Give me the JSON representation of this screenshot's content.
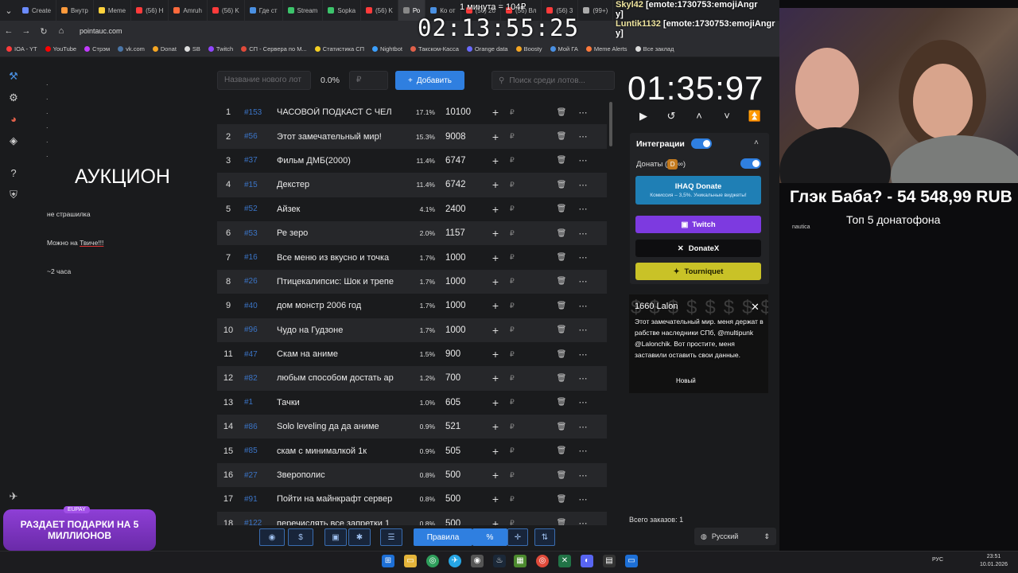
{
  "browser": {
    "tabs": [
      "Create",
      "Внутр",
      "Meme",
      "(56) Н",
      "Amruh",
      "(56) K",
      "Где ст",
      "Stream",
      "Sopka",
      "(56) K",
      "Ро",
      "Ко от",
      "(56) 2б",
      "(56) Вл",
      "(56) 3",
      "(99+)"
    ],
    "url": "pointauc.com",
    "bookmarks": [
      "IOA - YT",
      "YouTube",
      "Стрэм",
      "vk.com",
      "Donat",
      "SB",
      "Twitch",
      "СП - Сервера по М...",
      "Статистика СП",
      "Nightbot",
      "Такском-Касса",
      "Orange data",
      "Boosty",
      "Мой ГА",
      "Meme Alerts",
      "Все заклад"
    ]
  },
  "overlay": {
    "timer_label": "1 минута = 104₽",
    "timer": "02:13:55:25",
    "chat": [
      {
        "name": "Skyl42",
        "text": "[emote:1730753:emojiAngr"
      },
      {
        "name": "",
        "text": "y]"
      },
      {
        "name": "Luntik1132",
        "text": "[emote:1730753:emojiAngr"
      },
      {
        "name": "",
        "text": "y]"
      }
    ]
  },
  "notes": {
    "dots": [
      ".",
      ".",
      ".",
      ".",
      ".",
      "."
    ],
    "title": "АУКЦИОН",
    "line1": "не страшилка",
    "line2_prefix": "Можно на",
    "line2_link": "Твиче!!!",
    "line3": "~2 часа"
  },
  "controls": {
    "new_lot_placeholder": "Название нового лот",
    "percent": "0.0%",
    "rub_placeholder": "₽",
    "add_label": "Добавить",
    "search_placeholder": "Поиск среди лотов..."
  },
  "lots": [
    {
      "n": "1",
      "id": "#153",
      "name": "ЧАСОВОЙ ПОДКАСТ С ЧЕЛ",
      "pct": "17.1%",
      "amount": "10100"
    },
    {
      "n": "2",
      "id": "#56",
      "name": "Этот замечательный мир!",
      "pct": "15.3%",
      "amount": "9008"
    },
    {
      "n": "3",
      "id": "#37",
      "name": "Фильм ДМБ(2000)",
      "pct": "11.4%",
      "amount": "6747"
    },
    {
      "n": "4",
      "id": "#15",
      "name": "Декстер",
      "pct": "11.4%",
      "amount": "6742"
    },
    {
      "n": "5",
      "id": "#52",
      "name": "Айзек",
      "pct": "4.1%",
      "amount": "2400"
    },
    {
      "n": "6",
      "id": "#53",
      "name": "Ре зеро",
      "pct": "2.0%",
      "amount": "1157"
    },
    {
      "n": "7",
      "id": "#16",
      "name": "Все меню из вкусно и точка",
      "pct": "1.7%",
      "amount": "1000"
    },
    {
      "n": "8",
      "id": "#26",
      "name": "Птицекалипсис: Шок и трепе",
      "pct": "1.7%",
      "amount": "1000"
    },
    {
      "n": "9",
      "id": "#40",
      "name": "дом монстр 2006 год",
      "pct": "1.7%",
      "amount": "1000"
    },
    {
      "n": "10",
      "id": "#96",
      "name": "Чудо на Гудзоне",
      "pct": "1.7%",
      "amount": "1000"
    },
    {
      "n": "11",
      "id": "#47",
      "name": "Скам на аниме",
      "pct": "1.5%",
      "amount": "900"
    },
    {
      "n": "12",
      "id": "#82",
      "name": "любым способом достать ар",
      "pct": "1.2%",
      "amount": "700"
    },
    {
      "n": "13",
      "id": "#1",
      "name": "Тачки",
      "pct": "1.0%",
      "amount": "605"
    },
    {
      "n": "14",
      "id": "#86",
      "name": "Solo leveling да да аниме",
      "pct": "0.9%",
      "amount": "521"
    },
    {
      "n": "15",
      "id": "#85",
      "name": "скам с минималкой 1к",
      "pct": "0.9%",
      "amount": "505"
    },
    {
      "n": "16",
      "id": "#27",
      "name": "Зверополис",
      "pct": "0.8%",
      "amount": "500"
    },
    {
      "n": "17",
      "id": "#91",
      "name": "Пойти на майнкрафт сервер",
      "pct": "0.8%",
      "amount": "500"
    },
    {
      "n": "18",
      "id": "#122",
      "name": "перечислять все запретки 1",
      "pct": "0.8%",
      "amount": "500"
    }
  ],
  "lot_rub_symbol": "₽",
  "bottom": {
    "rules_label": "Правила",
    "percent_icon": "%",
    "total_label": "Всего заказов:",
    "total_value": "1",
    "language": "Русский"
  },
  "right": {
    "stopwatch": "01:35:97",
    "integrations_title": "Интеграции",
    "donates_label": "Донаты (",
    "donates_suffix": ")",
    "ihaq_label": "IHAQ Donate",
    "ihaq_sub": "Комиссия – 3,5%. Уникальные виджеты!",
    "twitch_label": "Twitch",
    "donatex_label": "DonateX",
    "tourniquet_label": "Tourniquet"
  },
  "donation": {
    "head": "1660 Lalon",
    "text": "Этот замечательный мир. меня держат в рабстве наследники СПб, @multipunk @Lalonchik. Вот простите, меня заставили оставить свои данные.",
    "status": "Новый"
  },
  "stream": {
    "donation_title": "Глэк Баба? - 54 548,99 RUB",
    "top_label": "Топ  5 донатофона",
    "nautica": "nautica"
  },
  "promo": {
    "badge": "EUPAY",
    "text": "РАЗДАЕТ ПОДАРКИ НА 5 МИЛЛИОНОВ"
  },
  "taskbar": {
    "lang": "РУС",
    "time": "23:51",
    "date": "10.01.2026"
  },
  "colors": {
    "accent": "#2f7fe0",
    "twitch": "#7d3ae0",
    "tourniquet": "#c9c227",
    "ihaq": "#1f7fb5",
    "lot_id": "#3b74c6"
  }
}
